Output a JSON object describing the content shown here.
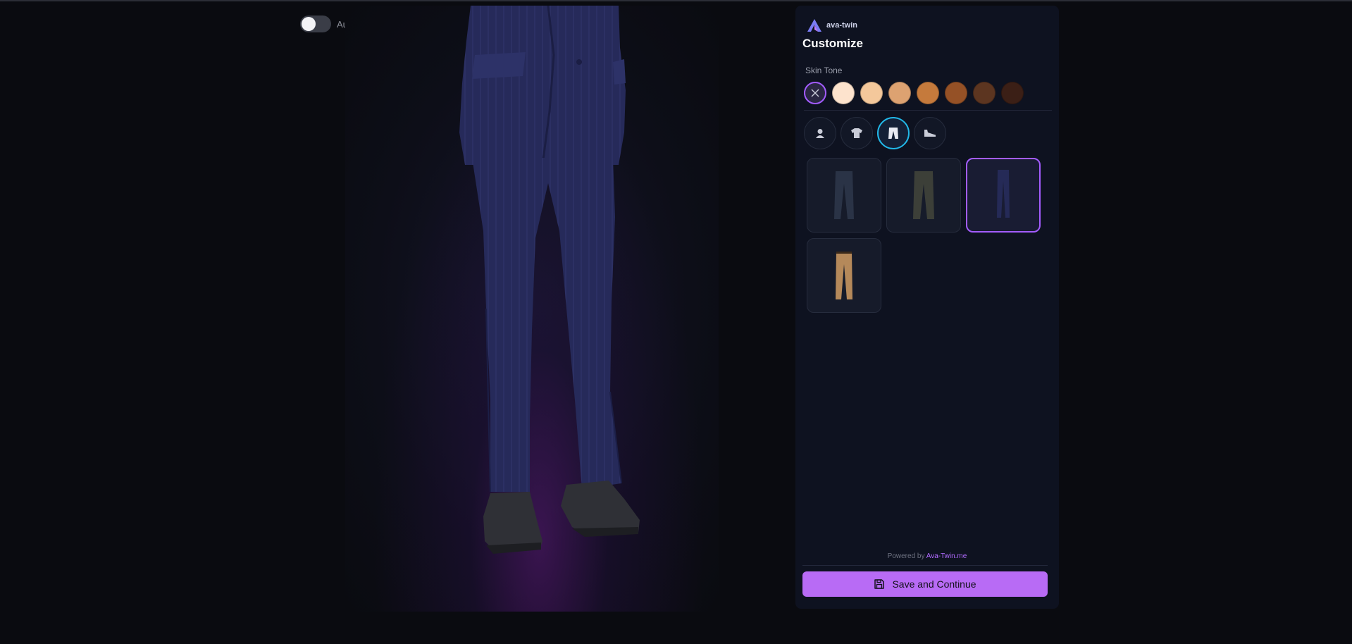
{
  "viewer": {
    "auto_rotate_label": "Auto Rotate",
    "auto_rotate_on": false
  },
  "panel": {
    "brand_name": "ava-twin",
    "title": "Customize",
    "skin_tone_label": "Skin Tone",
    "skin_tones": [
      "#fde3cd",
      "#f4c89b",
      "#dda271",
      "#c57a3c",
      "#955126",
      "#5c3520",
      "#3b1f16"
    ],
    "categories": [
      {
        "name": "head",
        "icon": "head-icon"
      },
      {
        "name": "top",
        "icon": "shirt-icon"
      },
      {
        "name": "bottom",
        "icon": "pants-icon",
        "active": true
      },
      {
        "name": "footwear",
        "icon": "shoe-icon"
      }
    ],
    "items": [
      {
        "name": "dark-jeans",
        "color": "#2a3346"
      },
      {
        "name": "dark-cargo",
        "color": "#3c3f38"
      },
      {
        "name": "navy-suit-trousers",
        "color": "#252a57",
        "active": true
      },
      {
        "name": "khaki-chinos",
        "color": "#b5895a"
      }
    ],
    "powered_by_text": "Powered by",
    "powered_by_link": "Ava-Twin.me",
    "save_label": "Save and Continue"
  },
  "colors": {
    "accent_purple": "#a35cff",
    "accent_cyan": "#22b8e8",
    "suit_navy": "#262a5a"
  }
}
